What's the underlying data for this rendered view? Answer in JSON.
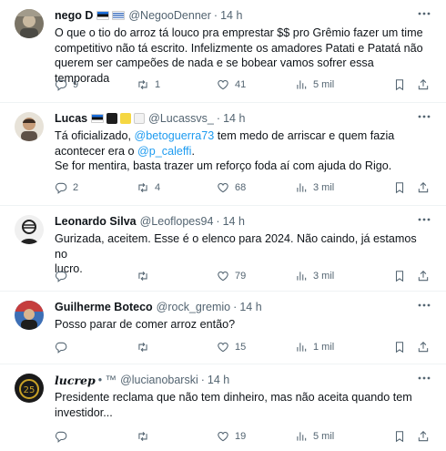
{
  "tweets": [
    {
      "name": "nego D",
      "handle": "@NegooDenner",
      "time": "14 h",
      "text_lines": [
        "O que o tio do arroz tá louco pra emprestar $$ pro Grêmio fazer um time",
        "competitivo não tá escrito. Infelizmente os amadores Patati e Patatá não",
        "querem ser campeões de nada e se bobear vamos sofrer essa temporada"
      ],
      "replies": "9",
      "retweets": "1",
      "likes": "41",
      "views": "5 mil",
      "flags": [
        "#1d3d8f",
        "#4a78c2"
      ]
    },
    {
      "name": "Lucas",
      "handle": "@Lucassvs_",
      "time": "14 h",
      "line1_pre": "Tá oficializado, ",
      "line1_mention": "@betoguerra73",
      "line1_post": " tem medo de arriscar e quem fazia",
      "line2_pre": "acontecer era o ",
      "line2_mention": "@p_caleffi",
      "line2_post": ".",
      "line3": "Se for mentira, basta trazer um reforço foda aí com ajuda do Rigo.",
      "replies": "2",
      "retweets": "4",
      "likes": "68",
      "views": "3 mil",
      "flags": [
        "#1d3d8f",
        "#1d1d1d",
        "#f5d742",
        "#d9d9d9"
      ]
    },
    {
      "name": "Leonardo Silva",
      "handle": "@Leoflopes94",
      "time": "14 h",
      "text_lines": [
        "Gurizada, aceitem. Esse é o elenco para 2024. Não caindo, já estamos no",
        "lucro."
      ],
      "replies": "",
      "retweets": "",
      "likes": "79",
      "views": "3 mil"
    },
    {
      "name": "Guilherme Boteco",
      "handle": "@rock_gremio",
      "time": "14 h",
      "text_lines": [
        "Posso parar de comer arroz então?"
      ],
      "replies": "",
      "retweets": "",
      "likes": "15",
      "views": "1 mil"
    },
    {
      "name": "lucrep",
      "handle": "@lucianobarski",
      "time": "14 h",
      "name_suffix": "• ™",
      "text_lines": [
        "Presidente reclama que não tem dinheiro, mas não aceita quando tem",
        "investidor..."
      ],
      "replies": "",
      "retweets": "",
      "likes": "19",
      "views": "5 mil"
    }
  ],
  "icons": {
    "reply": "reply-icon",
    "retweet": "retweet-icon",
    "like": "heart-icon",
    "views": "views-icon",
    "bookmark": "bookmark-icon",
    "share": "share-icon",
    "more": "more-icon"
  },
  "colors": {
    "link": "#1d9bf0",
    "secondary_text": "#536471",
    "divider": "#eff3f4"
  }
}
